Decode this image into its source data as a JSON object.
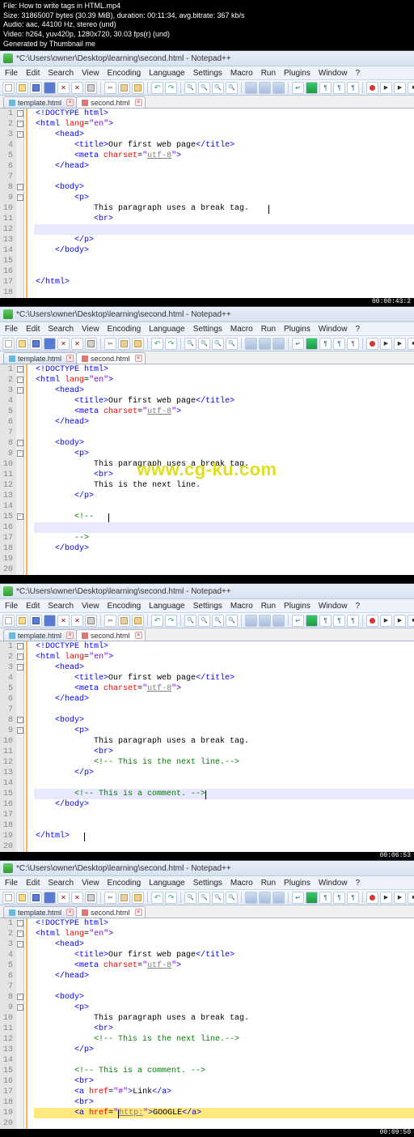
{
  "meta": {
    "file": "File: How to write tags in HTML.mp4",
    "size": "Size: 31865007 bytes (30.39 MiB), duration: 00:11:34, avg.bitrate: 367 kb/s",
    "audio": "Audio: aac, 44100 Hz, stereo (und)",
    "video": "Video: h264, yuv420p, 1280x720, 30.03 fps(r) (und)",
    "generated": "Generated by Thumbnail me"
  },
  "watermark": "www.cg-ku.com",
  "app": {
    "title": "*C:\\Users\\owner\\Desktop\\learning\\second.html - Notepad++",
    "menus": [
      "File",
      "Edit",
      "Search",
      "View",
      "Encoding",
      "Language",
      "Settings",
      "Macro",
      "Run",
      "Plugins",
      "Window",
      "?"
    ],
    "tabs": {
      "inactive": "template.html",
      "active": "second.html"
    }
  },
  "timestamps": [
    "00:00:43:2",
    "",
    "00:06:53",
    "00:09:50"
  ],
  "panes": [
    {
      "lines": [
        {
          "n": 1,
          "cls": "",
          "html": "<span class='tag'>&lt;!DOCTYPE html&gt;</span>",
          "fold": "box"
        },
        {
          "n": 2,
          "cls": "",
          "html": "<span class='tag'>&lt;html</span> <span class='attr'>lang</span>=<span class='val'>\"en\"</span><span class='tag'>&gt;</span>",
          "fold": "box"
        },
        {
          "n": 3,
          "cls": "",
          "ind": 1,
          "html": "<span class='tag'>&lt;head&gt;</span>",
          "fold": "box"
        },
        {
          "n": 4,
          "cls": "",
          "ind": 2,
          "html": "<span class='tag'>&lt;title&gt;</span><span class='txt'>Our first web page</span><span class='tag'>&lt;/title&gt;</span>"
        },
        {
          "n": 5,
          "cls": "",
          "ind": 2,
          "html": "<span class='tag'>&lt;meta</span> <span class='attr'>charset</span>=<span class='val'>\"</span><span class='str-u'>utf-8</span><span class='val'>\"</span><span class='tag'>&gt;</span>"
        },
        {
          "n": 6,
          "cls": "",
          "ind": 1,
          "html": "<span class='tag'>&lt;/head&gt;</span>"
        },
        {
          "n": 7,
          "cls": "",
          "html": ""
        },
        {
          "n": 8,
          "cls": "",
          "ind": 1,
          "html": "<span class='tag'>&lt;body&gt;</span>",
          "fold": "box"
        },
        {
          "n": 9,
          "cls": "",
          "ind": 2,
          "html": "<span class='tag'>&lt;p&gt;</span>",
          "fold": "box"
        },
        {
          "n": 10,
          "cls": "",
          "ind": 3,
          "html": "<span class='txt'>This paragraph uses a break tag.</span>    <span class='cursor'></span>"
        },
        {
          "n": 11,
          "cls": "",
          "ind": 3,
          "html": "<span class='tag'>&lt;br&gt;</span>"
        },
        {
          "n": 12,
          "cls": "hl-line",
          "ind": 3,
          "html": ""
        },
        {
          "n": 13,
          "cls": "",
          "ind": 2,
          "html": "<span class='tag'>&lt;/p&gt;</span>"
        },
        {
          "n": 14,
          "cls": "",
          "ind": 1,
          "html": "<span class='tag'>&lt;/body&gt;</span>"
        },
        {
          "n": 15,
          "cls": "",
          "html": ""
        },
        {
          "n": 16,
          "cls": "",
          "html": ""
        },
        {
          "n": 17,
          "cls": "",
          "html": "<span class='tag'>&lt;/html&gt;</span>"
        },
        {
          "n": 18,
          "cls": "",
          "html": ""
        }
      ]
    },
    {
      "lines": [
        {
          "n": 1,
          "cls": "",
          "html": "<span class='tag'>&lt;!DOCTYPE html&gt;</span>",
          "fold": "box"
        },
        {
          "n": 2,
          "cls": "",
          "html": "<span class='tag'>&lt;html</span> <span class='attr'>lang</span>=<span class='val'>\"en\"</span><span class='tag'>&gt;</span>",
          "fold": "box"
        },
        {
          "n": 3,
          "cls": "",
          "ind": 1,
          "html": "<span class='tag'>&lt;head&gt;</span>",
          "fold": "box"
        },
        {
          "n": 4,
          "cls": "",
          "ind": 2,
          "html": "<span class='tag'>&lt;title&gt;</span><span class='txt'>Our first web page</span><span class='tag'>&lt;/title&gt;</span>"
        },
        {
          "n": 5,
          "cls": "",
          "ind": 2,
          "html": "<span class='tag'>&lt;meta</span> <span class='attr'>charset</span>=<span class='val'>\"</span><span class='str-u'>utf-8</span><span class='val'>\"</span><span class='tag'>&gt;</span>"
        },
        {
          "n": 6,
          "cls": "",
          "ind": 1,
          "html": "<span class='tag'>&lt;/head&gt;</span>"
        },
        {
          "n": 7,
          "cls": "",
          "html": ""
        },
        {
          "n": 8,
          "cls": "",
          "ind": 1,
          "html": "<span class='tag'>&lt;body&gt;</span>",
          "fold": "box"
        },
        {
          "n": 9,
          "cls": "",
          "ind": 2,
          "html": "<span class='tag'>&lt;p&gt;</span>",
          "fold": "box"
        },
        {
          "n": 10,
          "cls": "",
          "ind": 3,
          "html": "<span class='txt'>This paragraph uses a break tag.</span>"
        },
        {
          "n": 11,
          "cls": "",
          "ind": 3,
          "html": "<span class='tag'>&lt;br&gt;</span>"
        },
        {
          "n": 12,
          "cls": "",
          "ind": 3,
          "html": "<span class='txt'>This is the next line.</span>"
        },
        {
          "n": 13,
          "cls": "",
          "ind": 2,
          "html": "<span class='tag'>&lt;/p&gt;</span>"
        },
        {
          "n": 14,
          "cls": "",
          "html": ""
        },
        {
          "n": 15,
          "cls": "",
          "ind": 2,
          "html": "<span class='comment'>&lt;!--</span>   <span class='cursor'></span>",
          "fold": "box"
        },
        {
          "n": 16,
          "cls": "hl-line",
          "ind": 2,
          "html": ""
        },
        {
          "n": 17,
          "cls": "",
          "ind": 2,
          "html": "<span class='comment'>--&gt;</span>"
        },
        {
          "n": 18,
          "cls": "",
          "ind": 1,
          "html": "<span class='tag'>&lt;/body&gt;</span>"
        },
        {
          "n": 19,
          "cls": "",
          "html": ""
        },
        {
          "n": 20,
          "cls": "",
          "html": ""
        }
      ]
    },
    {
      "lines": [
        {
          "n": 1,
          "cls": "",
          "html": "<span class='tag'>&lt;!DOCTYPE html&gt;</span>",
          "fold": "box"
        },
        {
          "n": 2,
          "cls": "",
          "html": "<span class='tag'>&lt;html</span> <span class='attr'>lang</span>=<span class='val'>\"en\"</span><span class='tag'>&gt;</span>",
          "fold": "box"
        },
        {
          "n": 3,
          "cls": "",
          "ind": 1,
          "html": "<span class='tag'>&lt;head&gt;</span>",
          "fold": "box"
        },
        {
          "n": 4,
          "cls": "",
          "ind": 2,
          "html": "<span class='tag'>&lt;title&gt;</span><span class='txt'>Our first web page</span><span class='tag'>&lt;/title&gt;</span>"
        },
        {
          "n": 5,
          "cls": "",
          "ind": 2,
          "html": "<span class='tag'>&lt;meta</span> <span class='attr'>charset</span>=<span class='val'>\"</span><span class='str-u'>utf-8</span><span class='val'>\"</span><span class='tag'>&gt;</span>"
        },
        {
          "n": 6,
          "cls": "",
          "ind": 1,
          "html": "<span class='tag'>&lt;/head&gt;</span>"
        },
        {
          "n": 7,
          "cls": "",
          "html": ""
        },
        {
          "n": 8,
          "cls": "",
          "ind": 1,
          "html": "<span class='tag'>&lt;body&gt;</span>",
          "fold": "box"
        },
        {
          "n": 9,
          "cls": "",
          "ind": 2,
          "html": "<span class='tag'>&lt;p&gt;</span>",
          "fold": "box"
        },
        {
          "n": 10,
          "cls": "",
          "ind": 3,
          "html": "<span class='txt'>This paragraph uses a break tag.</span>"
        },
        {
          "n": 11,
          "cls": "",
          "ind": 3,
          "html": "<span class='tag'>&lt;br&gt;</span>"
        },
        {
          "n": 12,
          "cls": "",
          "ind": 3,
          "html": "<span class='comment'>&lt;!-- This is the next line.--&gt;</span>"
        },
        {
          "n": 13,
          "cls": "",
          "ind": 2,
          "html": "<span class='tag'>&lt;/p&gt;</span>"
        },
        {
          "n": 14,
          "cls": "",
          "html": ""
        },
        {
          "n": 15,
          "cls": "hl-line",
          "ind": 2,
          "html": "<span class='comment'>&lt;!-- This is a comment. --&gt;</span><span class='cursor'></span>"
        },
        {
          "n": 16,
          "cls": "",
          "ind": 1,
          "html": "<span class='tag'>&lt;/body&gt;</span>"
        },
        {
          "n": 17,
          "cls": "",
          "html": ""
        },
        {
          "n": 18,
          "cls": "",
          "html": ""
        },
        {
          "n": 19,
          "cls": "",
          "html": "<span class='tag'>&lt;/html&gt;</span>   <span class='cursor'></span>"
        },
        {
          "n": 20,
          "cls": "",
          "html": ""
        }
      ]
    },
    {
      "lines": [
        {
          "n": 1,
          "cls": "",
          "html": "<span class='tag'>&lt;!DOCTYPE html&gt;</span>",
          "fold": "box"
        },
        {
          "n": 2,
          "cls": "",
          "html": "<span class='tag'>&lt;html</span> <span class='attr'>lang</span>=<span class='val'>\"en\"</span><span class='tag'>&gt;</span>",
          "fold": "box"
        },
        {
          "n": 3,
          "cls": "",
          "ind": 1,
          "html": "<span class='tag'>&lt;head&gt;</span>",
          "fold": "box"
        },
        {
          "n": 4,
          "cls": "",
          "ind": 2,
          "html": "<span class='tag'>&lt;title&gt;</span><span class='txt'>Our first web page</span><span class='tag'>&lt;/title&gt;</span>"
        },
        {
          "n": 5,
          "cls": "",
          "ind": 2,
          "html": "<span class='tag'>&lt;meta</span> <span class='attr'>charset</span>=<span class='val'>\"</span><span class='str-u'>utf-8</span><span class='val'>\"</span><span class='tag'>&gt;</span>"
        },
        {
          "n": 6,
          "cls": "",
          "ind": 1,
          "html": "<span class='tag'>&lt;/head&gt;</span>"
        },
        {
          "n": 7,
          "cls": "",
          "html": ""
        },
        {
          "n": 8,
          "cls": "",
          "ind": 1,
          "html": "<span class='tag'>&lt;body&gt;</span>",
          "fold": "box"
        },
        {
          "n": 9,
          "cls": "",
          "ind": 2,
          "html": "<span class='tag'>&lt;p&gt;</span>",
          "fold": "box"
        },
        {
          "n": 10,
          "cls": "",
          "ind": 3,
          "html": "<span class='txt'>This paragraph uses a break tag.</span>"
        },
        {
          "n": 11,
          "cls": "",
          "ind": 3,
          "html": "<span class='tag'>&lt;br&gt;</span>"
        },
        {
          "n": 12,
          "cls": "",
          "ind": 3,
          "html": "<span class='comment'>&lt;!-- This is the next line.--&gt;</span>"
        },
        {
          "n": 13,
          "cls": "",
          "ind": 2,
          "html": "<span class='tag'>&lt;/p&gt;</span>"
        },
        {
          "n": 14,
          "cls": "",
          "html": ""
        },
        {
          "n": 15,
          "cls": "",
          "ind": 2,
          "html": "<span class='comment'>&lt;!-- This is a comment. --&gt;</span>"
        },
        {
          "n": 16,
          "cls": "",
          "ind": 2,
          "html": "<span class='tag'>&lt;br&gt;</span>"
        },
        {
          "n": 17,
          "cls": "",
          "ind": 2,
          "html": "<span class='tag'>&lt;a</span> <span class='attr'>href</span>=<span class='val'>\"#\"</span><span class='tag'>&gt;</span><span class='txt'>Link</span><span class='tag'>&lt;/a&gt;</span>"
        },
        {
          "n": 18,
          "cls": "",
          "ind": 2,
          "html": "<span class='tag'>&lt;br&gt;</span>"
        },
        {
          "n": 19,
          "cls": "hl-line-yellow",
          "ind": 2,
          "html": "<span class='tag'>&lt;a</span> <span class='attr'>href</span>=<span class='val'>\"</span><span class='cursor'></span><span class='str-u'>http:</span><span class='val'>\"</span><span class='tag'>&gt;</span><span style='background:#ffe97f'>GOOGLE</span><span class='tag'>&lt;/a&gt;</span>"
        },
        {
          "n": 20,
          "cls": "",
          "html": ""
        }
      ]
    }
  ]
}
